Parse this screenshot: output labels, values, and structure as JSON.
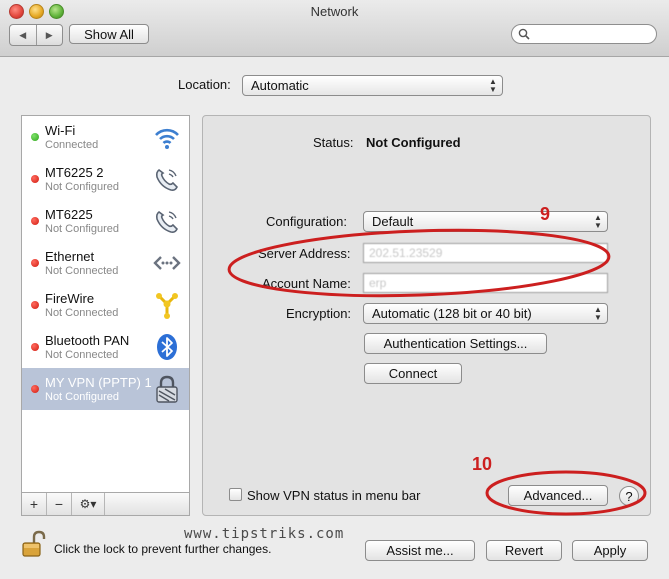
{
  "window": {
    "title": "Network"
  },
  "toolbar": {
    "back": "◀",
    "forward": "▶",
    "show_all": "Show All",
    "search_value": ""
  },
  "location": {
    "label": "Location:",
    "value": "Automatic"
  },
  "services": [
    {
      "name": "Wi-Fi",
      "status": "Connected",
      "dot": "green",
      "icon": "wifi-icon"
    },
    {
      "name": "MT6225  2",
      "status": "Not Configured",
      "dot": "red",
      "icon": "phone-icon"
    },
    {
      "name": "MT6225",
      "status": "Not Configured",
      "dot": "red",
      "icon": "phone-icon"
    },
    {
      "name": "Ethernet",
      "status": "Not Connected",
      "dot": "red",
      "icon": "ethernet-icon"
    },
    {
      "name": "FireWire",
      "status": "Not Connected",
      "dot": "red",
      "icon": "firewire-icon"
    },
    {
      "name": "Bluetooth PAN",
      "status": "Not Connected",
      "dot": "red",
      "icon": "bluetooth-icon"
    },
    {
      "name": "MY VPN (PPTP) 1",
      "status": "Not Configured",
      "dot": "red",
      "icon": "vpn-lock-icon",
      "selected": true
    }
  ],
  "sidebar_buttons": {
    "add": "+",
    "remove": "−",
    "gear": "⚙▾"
  },
  "detail": {
    "status_label": "Status:",
    "status_value": "Not Configured",
    "configuration_label": "Configuration:",
    "configuration_value": "Default",
    "server_label": "Server Address:",
    "server_value": "202.51.23529",
    "account_label": "Account Name:",
    "account_value": "erp",
    "encryption_label": "Encryption:",
    "encryption_value": "Automatic (128 bit or 40 bit)",
    "auth_button": "Authentication Settings...",
    "connect_button": "Connect",
    "show_status_label": "Show VPN status in menu bar",
    "advanced_button": "Advanced...",
    "help_button": "?"
  },
  "footer": {
    "lock_text": "Click the lock to prevent further changes.",
    "assist_button": "Assist me...",
    "revert_button": "Revert",
    "apply_button": "Apply"
  },
  "watermark": "www.tipstriks.com",
  "annotations": {
    "step9": "9",
    "step10": "10",
    "color": "#cc1f1f"
  }
}
